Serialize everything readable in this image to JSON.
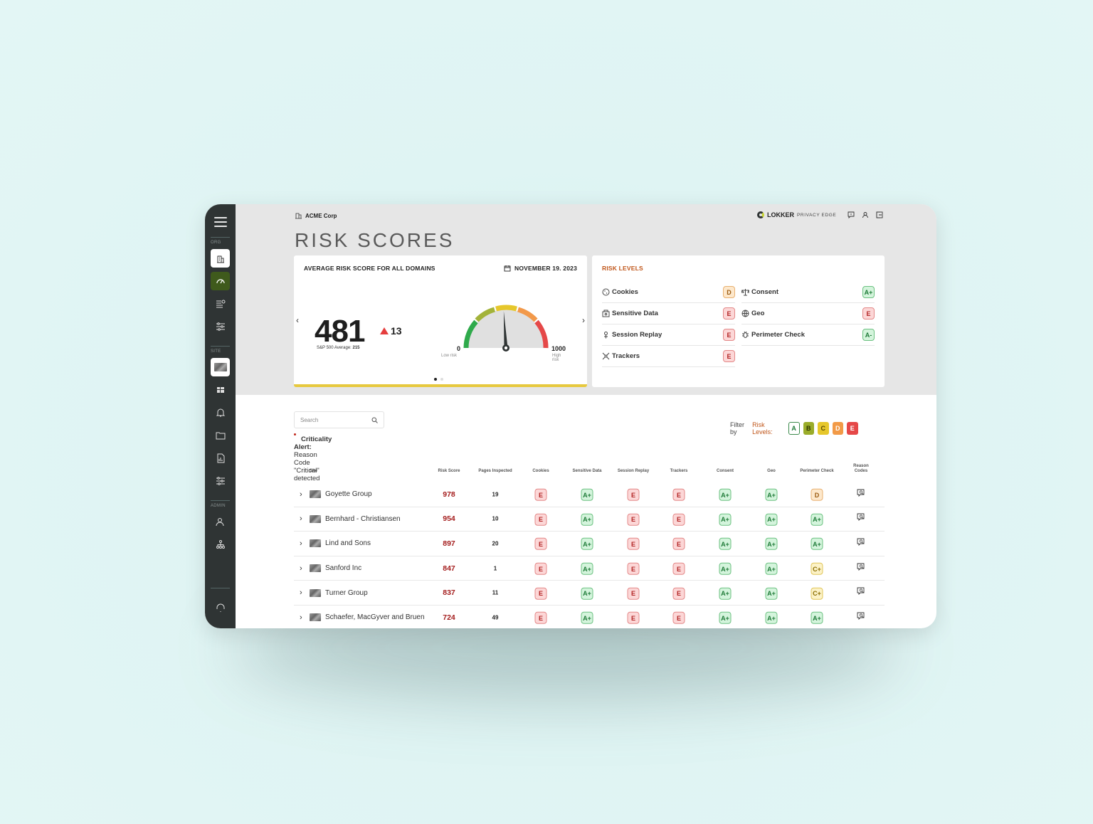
{
  "sidebar": {
    "sections": {
      "org": "ORG",
      "site": "SITE",
      "admin": "ADMIN"
    }
  },
  "header": {
    "org_name": "ACME Corp",
    "brand_name": "LOKKER",
    "brand_tag": "PRIVACY EDGE",
    "page_title": "RISK SCORES"
  },
  "avg_card": {
    "title": "AVERAGE RISK SCORE FOR ALL DOMAINS",
    "date": "NOVEMBER 19. 2023",
    "score": "481",
    "delta": "13",
    "benchmark_label": "S&P 500 Average:",
    "benchmark_value": "215",
    "gauge_value": 481,
    "gauge_min": "0",
    "gauge_max": "1000",
    "gauge_min_label": "Low risk",
    "gauge_max_label": "High risk"
  },
  "risk_levels": {
    "title": "RISK LEVELS",
    "items": [
      {
        "label": "Cookies",
        "grade": "D"
      },
      {
        "label": "Sensitive Data",
        "grade": "E"
      },
      {
        "label": "Session Replay",
        "grade": "E"
      },
      {
        "label": "Trackers",
        "grade": "E"
      },
      {
        "label": "Consent",
        "grade": "A+"
      },
      {
        "label": "Geo",
        "grade": "E"
      },
      {
        "label": "Perimeter Check",
        "grade": "A-"
      }
    ]
  },
  "search": {
    "placeholder": "Search"
  },
  "alert": {
    "title": "Criticality Alert:",
    "text": "Reason Code \"Critical\" detected"
  },
  "filter": {
    "label": "Filter by",
    "accent": "Risk Levels:",
    "levels": [
      "A",
      "B",
      "C",
      "D",
      "E"
    ]
  },
  "table": {
    "headers": [
      "Site",
      "Risk Score",
      "Pages Inspected",
      "Cookies",
      "Sensitive Data",
      "Session Replay",
      "Trackers",
      "Consent",
      "Geo",
      "Perimeter Check",
      "Reason Codes"
    ],
    "rows": [
      {
        "site": "Goyette Group",
        "score": "978",
        "pages": "19",
        "grades": [
          "E",
          "A+",
          "E",
          "E",
          "A+",
          "A+",
          "D"
        ]
      },
      {
        "site": "Bernhard - Christiansen",
        "score": "954",
        "pages": "10",
        "grades": [
          "E",
          "A+",
          "E",
          "E",
          "A+",
          "A+",
          "A+"
        ]
      },
      {
        "site": "Lind and Sons",
        "score": "897",
        "pages": "20",
        "grades": [
          "E",
          "A+",
          "E",
          "E",
          "A+",
          "A+",
          "A+"
        ]
      },
      {
        "site": "Sanford Inc",
        "score": "847",
        "pages": "1",
        "grades": [
          "E",
          "A+",
          "E",
          "E",
          "A+",
          "A+",
          "C+"
        ]
      },
      {
        "site": "Turner Group",
        "score": "837",
        "pages": "11",
        "grades": [
          "E",
          "A+",
          "E",
          "E",
          "A+",
          "A+",
          "C+"
        ]
      },
      {
        "site": "Schaefer, MacGyver and Bruen",
        "score": "724",
        "pages": "49",
        "grades": [
          "E",
          "A+",
          "E",
          "E",
          "A+",
          "A+",
          "A+"
        ]
      }
    ]
  }
}
